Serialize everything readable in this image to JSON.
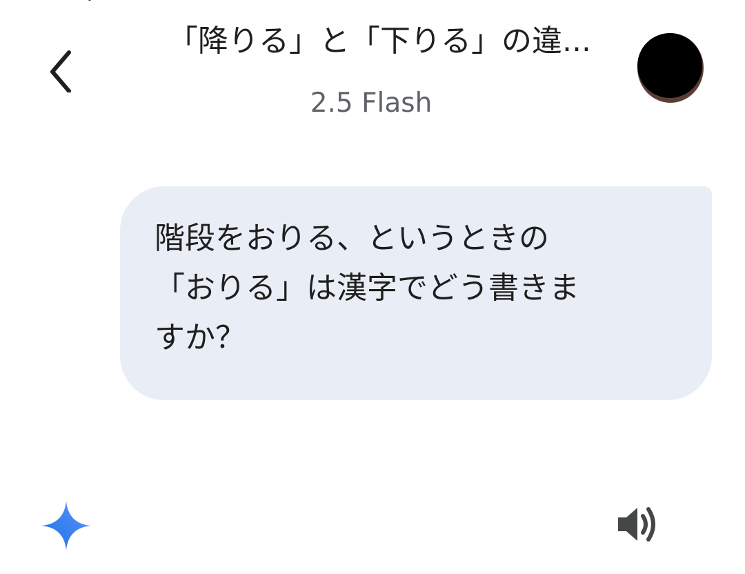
{
  "header": {
    "title": "「降りる」と「下りる」の違...",
    "model": "2.5 Flash",
    "back_icon": "chevron-left-icon",
    "avatar_icon": "user-avatar"
  },
  "conversation": {
    "user_message_lines": [
      "階段をおりる、というときの",
      "「おりる」は漢字でどう書きま",
      "すか？"
    ]
  },
  "response": {
    "assistant_icon": "gemini-spark-icon",
    "speaker_icon": "speaker-icon"
  },
  "colors": {
    "bubble_bg": "#e9eef6",
    "text": "#1f1f1f",
    "muted_text": "#5f6368",
    "spark_blue": "#4285f4"
  }
}
